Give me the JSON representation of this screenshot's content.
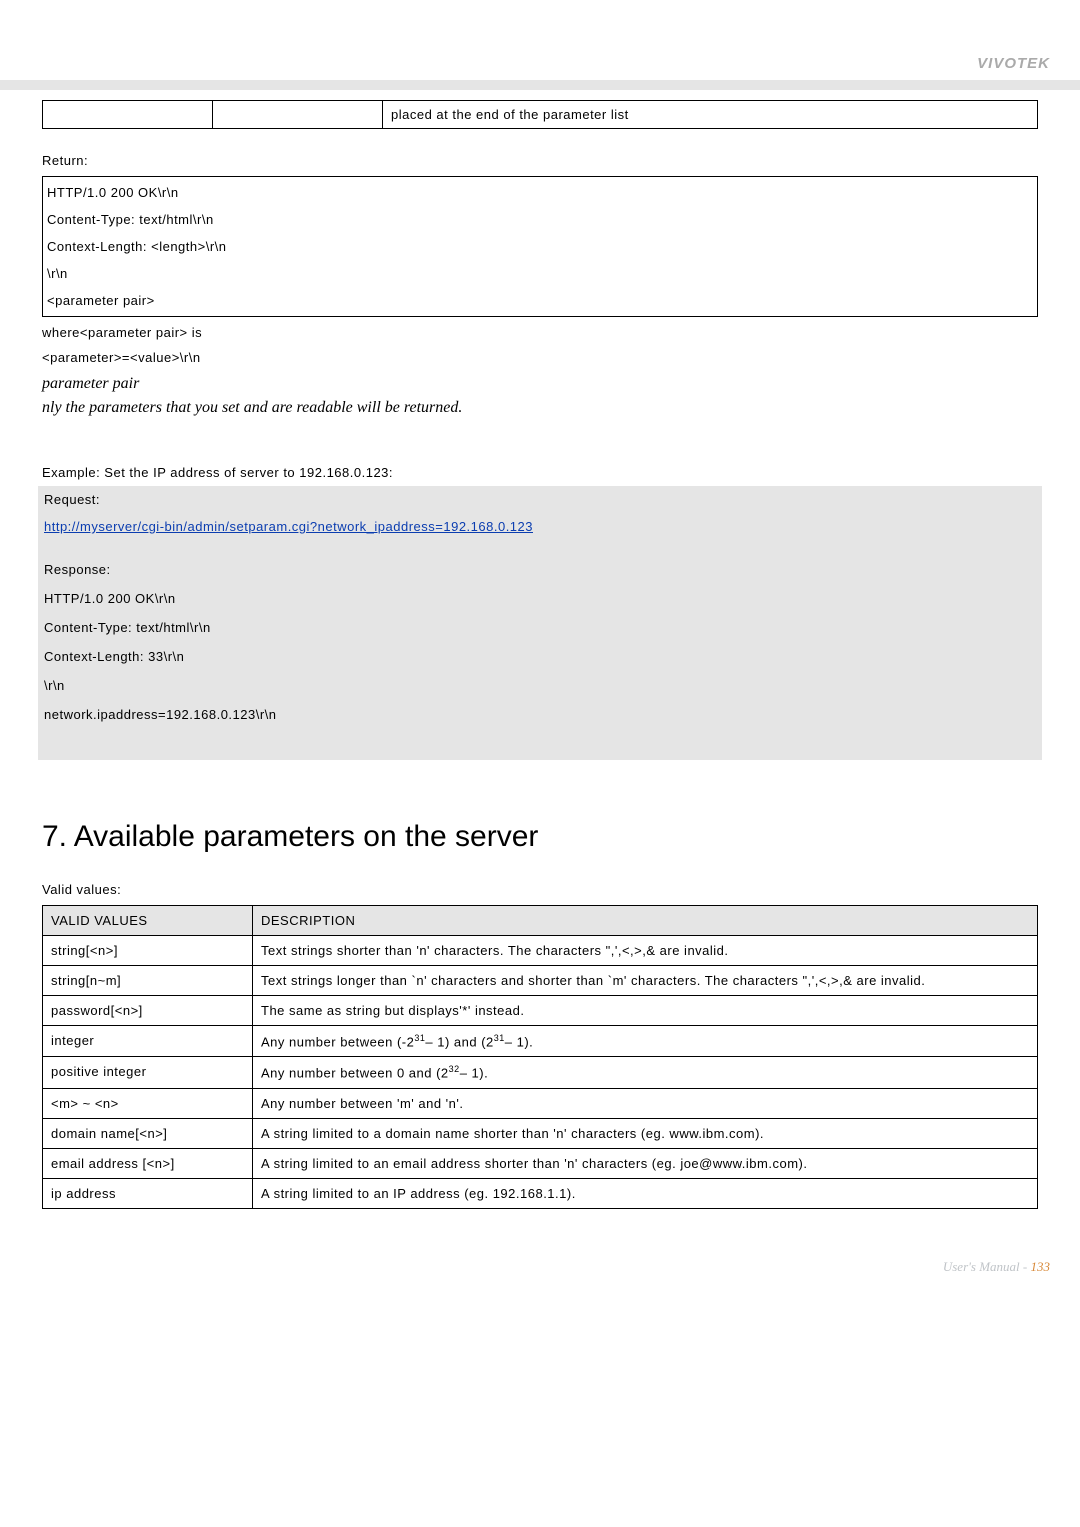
{
  "brand": "VIVOTEK",
  "top_table": {
    "col3": "placed at the end of the parameter list"
  },
  "return_label": "Return:",
  "return_lines": [
    "HTTP/1.0 200 OK\\r\\n",
    "Content-Type: text/html\\r\\n",
    "Context-Length: <length>\\r\\n",
    "\\r\\n",
    "<parameter pair>"
  ],
  "where_line": "where<parameter pair> is",
  "param_value_line": "<parameter>=<value>\\r\\n",
  "italic1": "parameter pair",
  "italic2": "nly the parameters that you set and are readable will be returned.",
  "example_label": "Example:    Set the IP address of server to 192.168.0.123:",
  "request_label": "Request:",
  "request_url": "http://myserver/cgi-bin/admin/setparam.cgi?network_ipaddress=192.168.0.123",
  "response_label": "Response:",
  "response_lines": [
    "HTTP/1.0 200 OK\\r\\n",
    "Content-Type: text/html\\r\\n",
    "Context-Length: 33\\r\\n",
    "\\r\\n",
    "network.ipaddress=192.168.0.123\\r\\n"
  ],
  "section_heading": "7. Available parameters on the server",
  "valid_values_label": "Valid values:",
  "table_headers": {
    "c1": "VALID VALUES",
    "c2": "DESCRIPTION"
  },
  "rows": [
    {
      "v": "string[<n>]",
      "d": "Text strings shorter than 'n' characters. The characters \",',<,>,& are invalid."
    },
    {
      "v": "string[n~m]",
      "d": "Text strings longer than `n' characters and shorter than `m' characters. The characters \",',<,>,& are invalid."
    },
    {
      "v": "password[<n>]",
      "d": "The same as string but displays'*' instead."
    },
    {
      "v": "integer",
      "d_html": "Any number between (-2<sup>31</sup>– 1) and (2<sup>31</sup>– 1)."
    },
    {
      "v": "positive integer",
      "d_html": "Any number between 0 and (2<sup>32</sup>– 1)."
    },
    {
      "v": "<m> ~ <n>",
      "d": "Any number between 'm' and 'n'."
    },
    {
      "v": "domain name[<n>]",
      "d": "A string limited to a domain name shorter than 'n' characters (eg. www.ibm.com)."
    },
    {
      "v": "email address [<n>]",
      "d": "A string limited to an email address shorter than 'n' characters (eg. joe@www.ibm.com)."
    },
    {
      "v": "ip address",
      "d": "A string limited to an IP address (eg. 192.168.1.1)."
    }
  ],
  "footer_text": "User's Manual - ",
  "footer_page": "133"
}
